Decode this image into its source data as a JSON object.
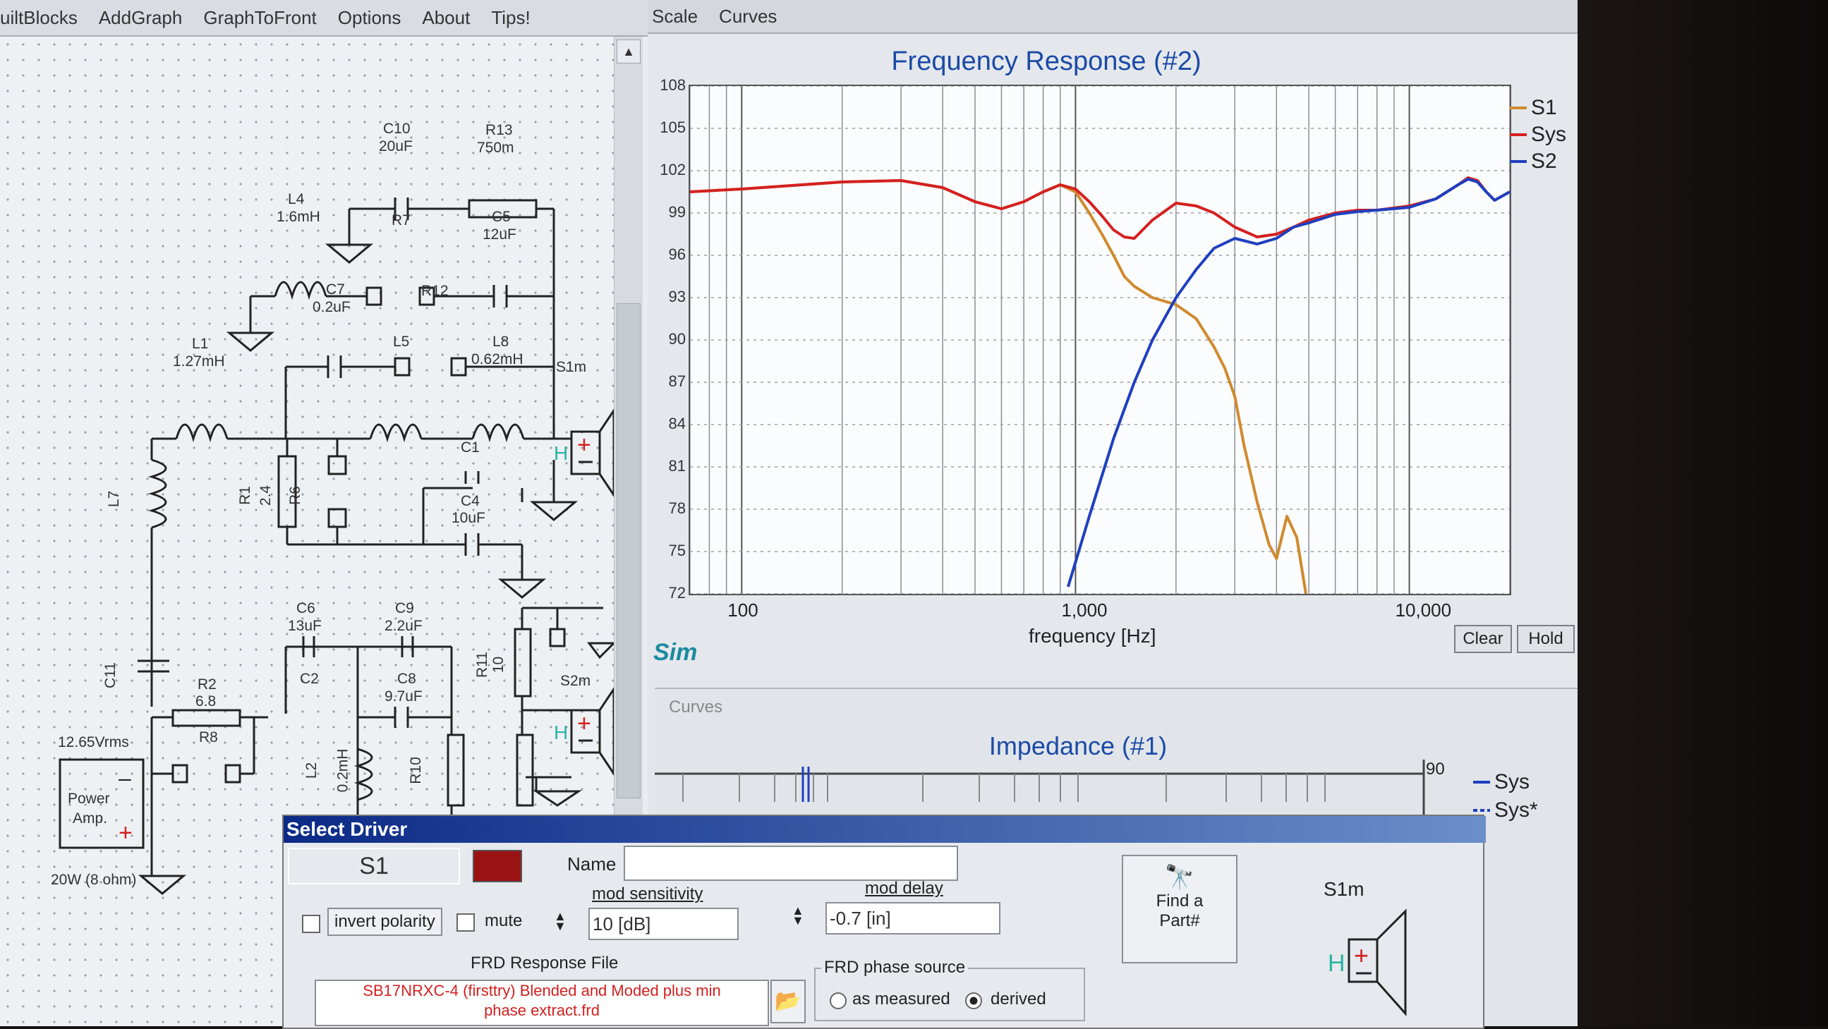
{
  "left_window": {
    "menu": [
      "uiltBlocks",
      "AddGraph",
      "GraphToFront",
      "Options",
      "About",
      "Tips!"
    ],
    "scroll_up_glyph": "▲",
    "schematic_labels": {
      "c10": "C10",
      "c10v": "20uF",
      "r13": "R13",
      "r13v": "750m",
      "l4": "L4",
      "l4v": "1.6mH",
      "r7": "R7",
      "c5": "C5",
      "c5v": "12uF",
      "c7": "C7",
      "c7v": "0.2uF",
      "r12": "R12",
      "l5": "L5",
      "l1": "L1",
      "l1v": "1.27mH",
      "l8": "L8",
      "l8v": "0.62mH",
      "s1m": "S1m",
      "l7": "L7",
      "r1": "R1",
      "r1v": "2.4",
      "r6": "R6",
      "c1": "C1",
      "c4": "C4",
      "c4v": "10uF",
      "c6": "C6",
      "c6v": "13uF",
      "c9": "C9",
      "c9v": "2.2uF",
      "c11": "C11",
      "c2": "C2",
      "c8": "C8",
      "c8v": "9.7uF",
      "r2": "R2",
      "r2v": "6.8",
      "r8": "R8",
      "r11": "R11",
      "r11v": "10",
      "s2m": "S2m",
      "vrms": "12.65Vrms",
      "amp1": "Power",
      "amp2": "Amp.",
      "l2": "L2",
      "l2v": "0.2mH",
      "r10": "R10",
      "watts": "20W (8 ohm)"
    }
  },
  "right_window": {
    "menu": [
      "Scale",
      "Curves"
    ],
    "freq_response": {
      "title": "Frequency Response (#2)",
      "xlabel": "frequency [Hz]",
      "sim_label": "Sim",
      "clear_button": "Clear",
      "hold_button": "Hold"
    },
    "impedance": {
      "curves_tab": "Curves",
      "title": "Impedance (#1)",
      "right_tick": "90",
      "legend": [
        "Sys",
        "Sys*"
      ]
    }
  },
  "chart_data": {
    "type": "line",
    "title": "Frequency Response (#2)",
    "xlabel": "frequency [Hz]",
    "ylabel": "",
    "xscale": "log",
    "xlim": [
      70,
      20000
    ],
    "ylim": [
      72,
      108
    ],
    "x_ticks": [
      100,
      1000,
      10000
    ],
    "x_tick_labels": [
      "100",
      "1,000",
      "10,000"
    ],
    "y_ticks": [
      72,
      75,
      78,
      81,
      84,
      87,
      90,
      93,
      96,
      99,
      102,
      105,
      108
    ],
    "grid": true,
    "legend_position": "right",
    "series": [
      {
        "name": "S1",
        "color": "#cf8a2e",
        "x": [
          70,
          100,
          200,
          300,
          400,
          500,
          600,
          700,
          800,
          900,
          1000,
          1100,
          1200,
          1300,
          1400,
          1500,
          1700,
          2000,
          2300,
          2600,
          2800,
          3000,
          3200,
          3500,
          3800,
          4000,
          4300,
          4600,
          4900
        ],
        "y": [
          100.5,
          100.7,
          101.2,
          101.3,
          100.8,
          99.8,
          99.3,
          99.8,
          100.5,
          101.0,
          100.5,
          99.0,
          97.5,
          96.0,
          94.5,
          93.8,
          93.0,
          92.5,
          91.5,
          89.5,
          88.0,
          86.0,
          82.5,
          78.5,
          75.5,
          74.5,
          77.5,
          76.0,
          72.0
        ]
      },
      {
        "name": "Sys",
        "color": "#d42020",
        "x": [
          70,
          100,
          200,
          300,
          400,
          500,
          600,
          700,
          800,
          900,
          1000,
          1100,
          1200,
          1300,
          1400,
          1500,
          1700,
          2000,
          2300,
          2600,
          3000,
          3500,
          4000,
          4500,
          5000,
          6000,
          7000,
          8000,
          10000,
          12000,
          14000,
          15000,
          16000,
          17000,
          18000,
          20000
        ],
        "y": [
          100.5,
          100.7,
          101.2,
          101.3,
          100.8,
          99.8,
          99.3,
          99.8,
          100.5,
          101.0,
          100.7,
          99.8,
          98.8,
          97.8,
          97.3,
          97.2,
          98.5,
          99.7,
          99.5,
          99.0,
          98.0,
          97.3,
          97.5,
          98.0,
          98.5,
          99.0,
          99.2,
          99.2,
          99.5,
          100.0,
          101.0,
          101.5,
          101.3,
          100.5,
          99.9,
          100.5
        ]
      },
      {
        "name": "S2",
        "color": "#1f3fbf",
        "x": [
          950,
          1100,
          1300,
          1500,
          1700,
          2000,
          2300,
          2600,
          3000,
          3500,
          4000,
          4500,
          5000,
          6000,
          7000,
          8000,
          10000,
          12000,
          14000,
          15000,
          16000,
          17000,
          18000,
          20000
        ],
        "y": [
          72.5,
          77.5,
          83.0,
          87.0,
          90.0,
          93.0,
          95.0,
          96.5,
          97.2,
          96.8,
          97.2,
          98.0,
          98.3,
          98.9,
          99.1,
          99.2,
          99.4,
          100.0,
          101.0,
          101.4,
          101.2,
          100.5,
          99.9,
          100.5
        ]
      }
    ]
  },
  "dialog": {
    "title": "Select Driver",
    "driver_id": "S1",
    "driver_color": "#9b1212",
    "name_label": "Name",
    "name_value": "",
    "invert_label": "invert polarity",
    "mute_label": "mute",
    "mod_sensitivity_label": "mod sensitivity",
    "mod_sensitivity_value": "10 [dB]",
    "mod_delay_label": "mod delay",
    "mod_delay_value": "-0.7 [in]",
    "find_label_1": "Find a",
    "find_label_2": "Part#",
    "frd_label": "FRD Response File",
    "frd_value_1": "SB17NRXC-4 (firsttry) Blended and Moded plus min",
    "frd_value_2": "phase extract.frd",
    "phase_source_label": "FRD phase source",
    "as_measured": "as measured",
    "derived": "derived",
    "preview_label": "S1m"
  }
}
